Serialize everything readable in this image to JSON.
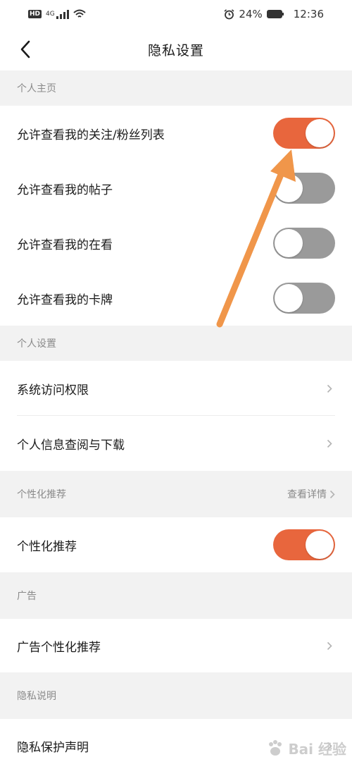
{
  "status": {
    "hd": "HD",
    "net": "4G",
    "battery": "24%",
    "time": "12:36"
  },
  "nav": {
    "title": "隐私设置"
  },
  "sections": {
    "personal_home": {
      "header": "个人主页",
      "rows": [
        {
          "label": "允许查看我的关注/粉丝列表",
          "toggle": "on"
        },
        {
          "label": "允许查看我的帖子",
          "toggle": "off"
        },
        {
          "label": "允许查看我的在看",
          "toggle": "off"
        },
        {
          "label": "允许查看我的卡牌",
          "toggle": "off"
        }
      ]
    },
    "personal_settings": {
      "header": "个人设置",
      "rows": [
        {
          "label": "系统访问权限"
        },
        {
          "label": "个人信息查阅与下载"
        }
      ]
    },
    "recommend": {
      "header": "个性化推荐",
      "detail": "查看详情",
      "rows": [
        {
          "label": "个性化推荐",
          "toggle": "on"
        }
      ]
    },
    "ads": {
      "header": "广告",
      "rows": [
        {
          "label": "广告个性化推荐"
        }
      ]
    },
    "privacy_info": {
      "header": "隐私说明",
      "rows": [
        {
          "label": "隐私保护声明"
        }
      ]
    }
  },
  "colors": {
    "accent": "#e8663d",
    "toggle_off": "#9a9a9a",
    "annotation_arrow": "#f0964a"
  },
  "watermark": "Bai 经验"
}
